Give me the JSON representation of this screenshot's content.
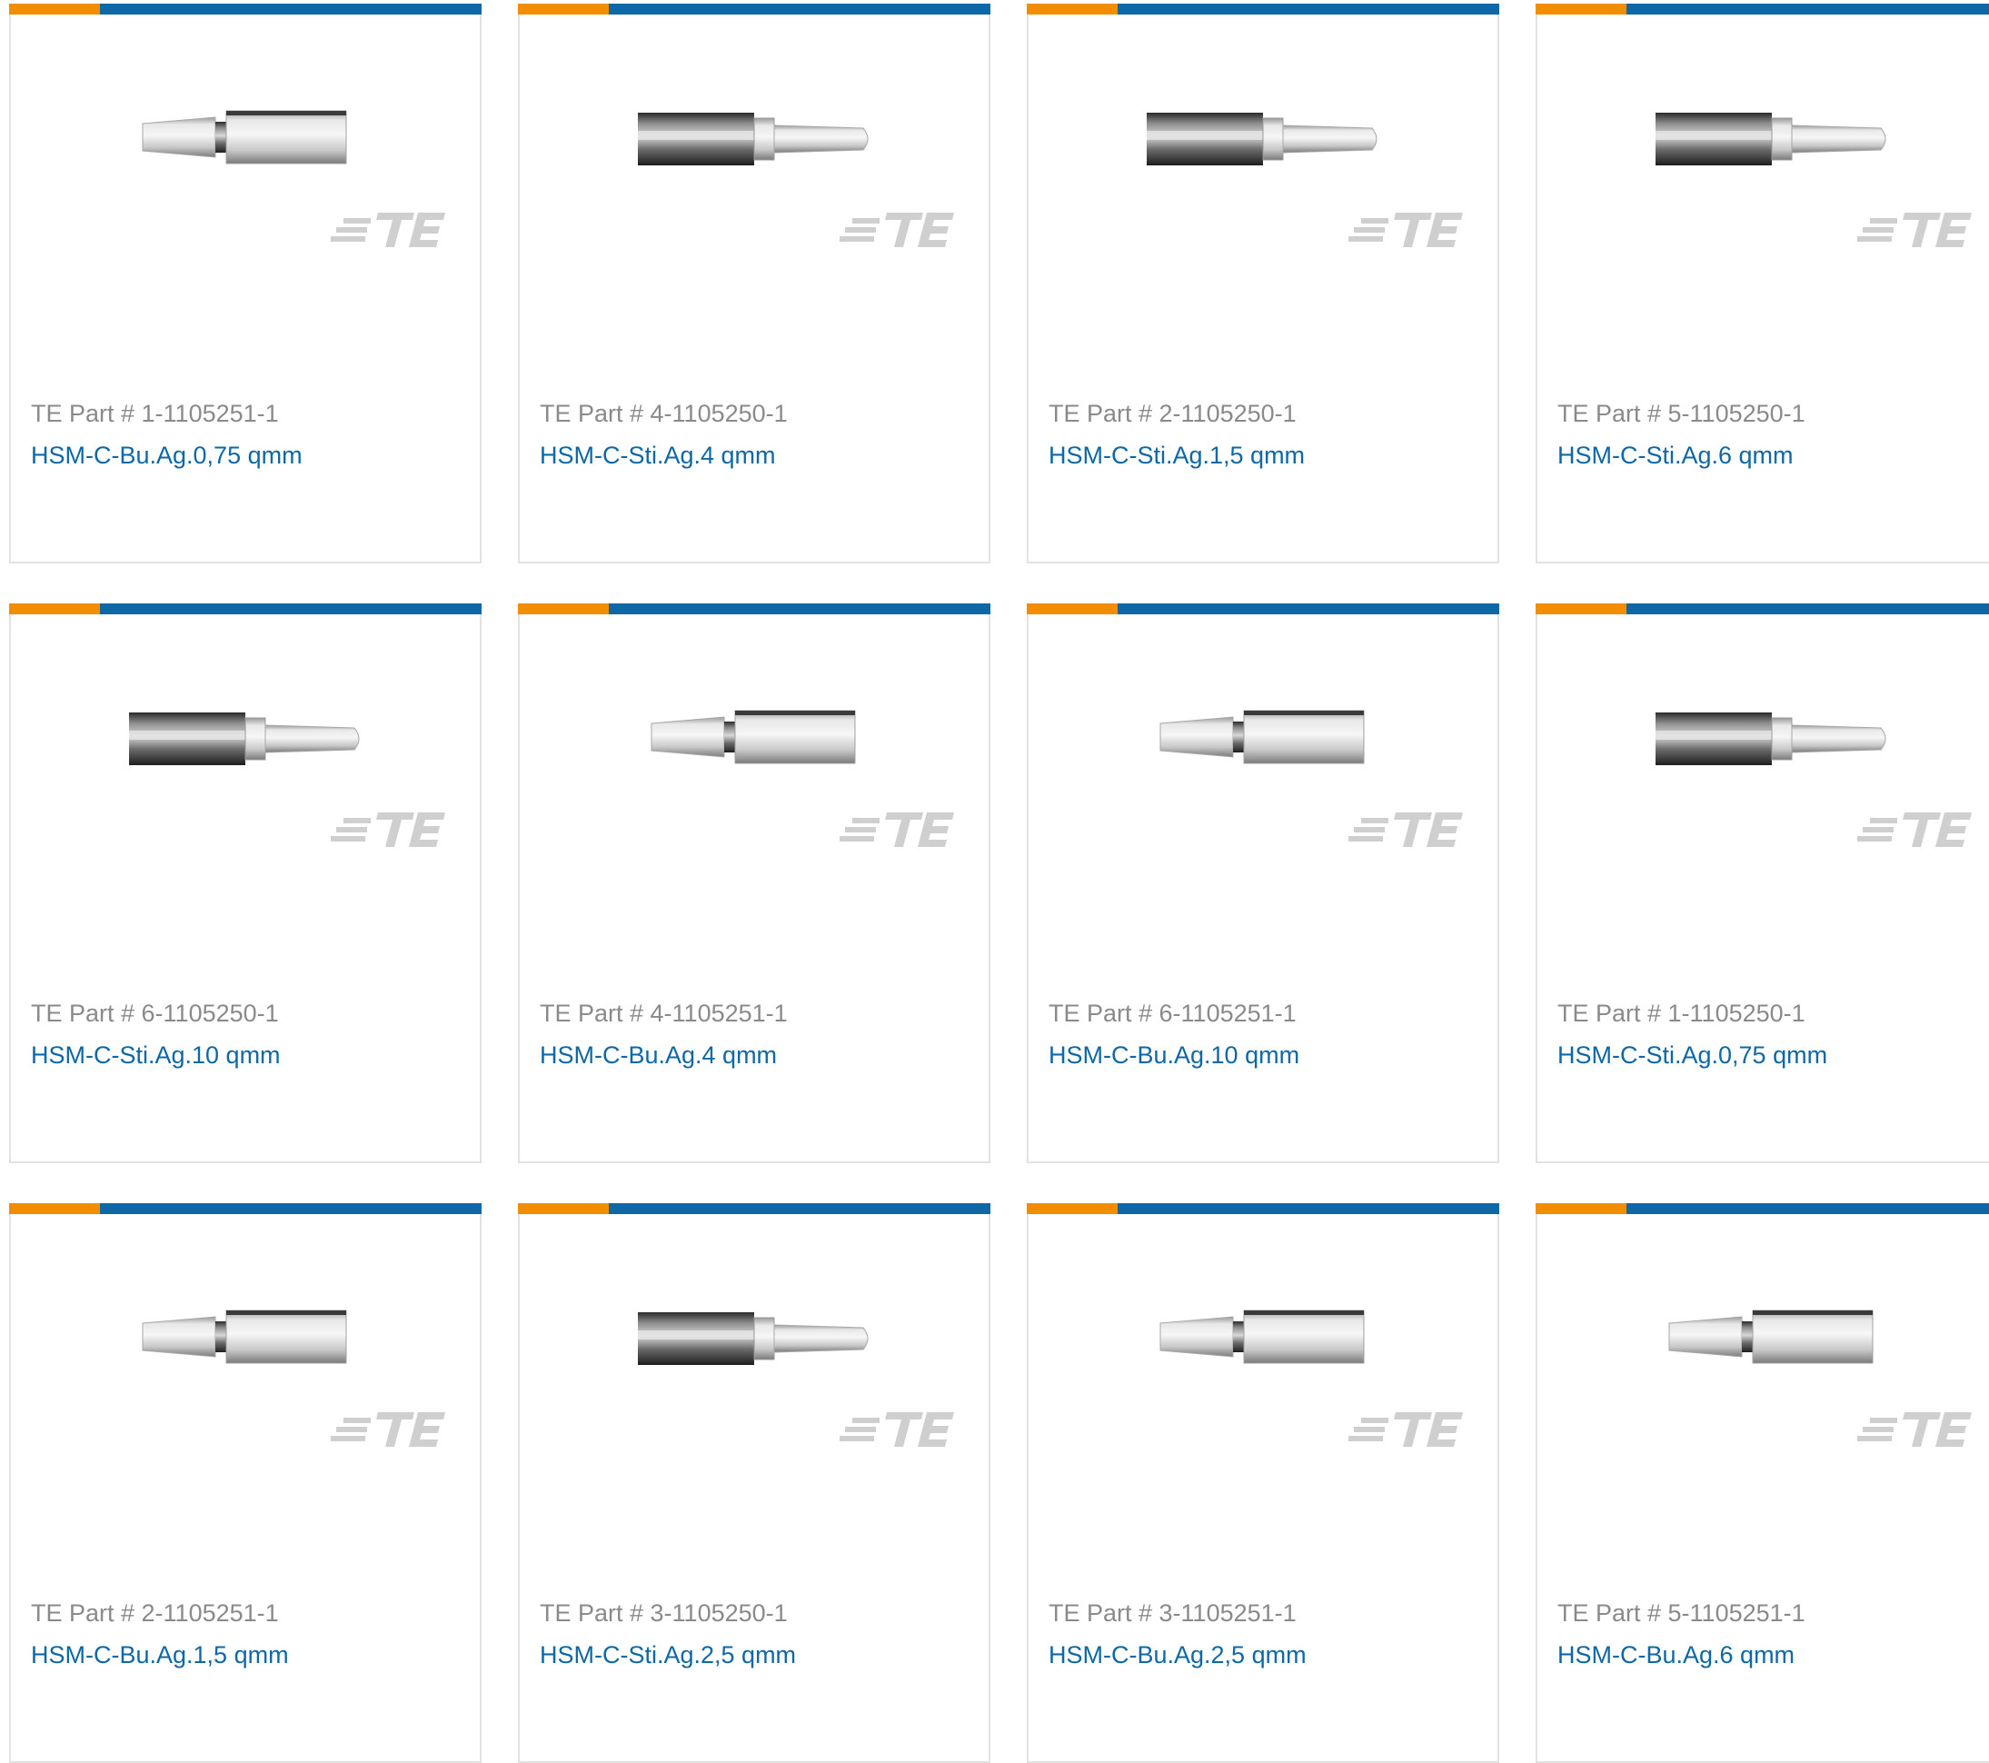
{
  "colors": {
    "accent_orange": "#f28d00",
    "accent_blue": "#0e68a6",
    "part_text": "#8a8a8a",
    "link_text": "#0e68a6",
    "border": "#e2e2e2"
  },
  "logo": {
    "name": "te-logo-icon",
    "text": "TE"
  },
  "products": [
    {
      "part_number": "TE Part # 1-1105251-1",
      "name": "HSM-C-Bu.Ag.0,75 qmm",
      "contact_type": "socket"
    },
    {
      "part_number": "TE Part # 4-1105250-1",
      "name": "HSM-C-Sti.Ag.4 qmm",
      "contact_type": "pin"
    },
    {
      "part_number": "TE Part # 2-1105250-1",
      "name": "HSM-C-Sti.Ag.1,5 qmm",
      "contact_type": "pin"
    },
    {
      "part_number": "TE Part # 5-1105250-1",
      "name": "HSM-C-Sti.Ag.6 qmm",
      "contact_type": "pin"
    },
    {
      "part_number": "TE Part # 6-1105250-1",
      "name": "HSM-C-Sti.Ag.10 qmm",
      "contact_type": "pin"
    },
    {
      "part_number": "TE Part # 4-1105251-1",
      "name": "HSM-C-Bu.Ag.4 qmm",
      "contact_type": "socket"
    },
    {
      "part_number": "TE Part # 6-1105251-1",
      "name": "HSM-C-Bu.Ag.10 qmm",
      "contact_type": "socket"
    },
    {
      "part_number": "TE Part # 1-1105250-1",
      "name": "HSM-C-Sti.Ag.0,75 qmm",
      "contact_type": "pin"
    },
    {
      "part_number": "TE Part # 2-1105251-1",
      "name": "HSM-C-Bu.Ag.1,5 qmm",
      "contact_type": "socket"
    },
    {
      "part_number": "TE Part # 3-1105250-1",
      "name": "HSM-C-Sti.Ag.2,5 qmm",
      "contact_type": "pin"
    },
    {
      "part_number": "TE Part # 3-1105251-1",
      "name": "HSM-C-Bu.Ag.2,5 qmm",
      "contact_type": "socket"
    },
    {
      "part_number": "TE Part # 5-1105251-1",
      "name": "HSM-C-Bu.Ag.6 qmm",
      "contact_type": "socket"
    }
  ]
}
